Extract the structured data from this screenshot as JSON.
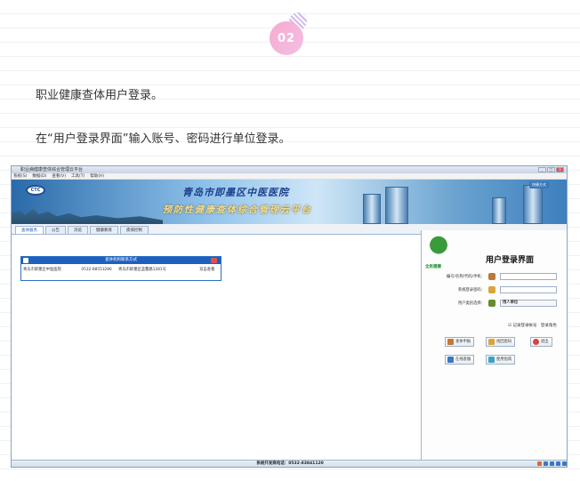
{
  "step_badge": "02",
  "paragraphs": {
    "p1": "职业健康查体用户登录。",
    "p2": "在“用户登录界面”输入账号、密码进行单位登录。"
  },
  "window": {
    "title": "职业病健康查体综合管理云平台",
    "menu": [
      "系统(S)",
      "数据(D)",
      "查看(V)",
      "工具(T)",
      "帮助(H)"
    ],
    "shortcut_label": "快捷方式"
  },
  "banner": {
    "logo_text": "CTC",
    "hospital": "青岛市即墨区中医医院",
    "platform": "预防性健康查体综合管理云平台"
  },
  "tabs": [
    "查体服务",
    "公告",
    "浏览",
    "健康教育",
    "疾病控制"
  ],
  "contact_panel": {
    "header": "查体机构联系方式",
    "name": "青岛市即墨区中医医院",
    "phone": "0532-88553286",
    "address": "青岛市即墨区蓝鳌路1281号",
    "action": "双击查看"
  },
  "login": {
    "logo_caption": "全民健康",
    "title": "用户登录界面",
    "fields": [
      {
        "label": "编号/名称/代码/手机：",
        "value": "",
        "icon": "user-icon"
      },
      {
        "label": "系统登录密码：",
        "value": "",
        "icon": "lock-icon"
      },
      {
        "label": "用户类别选择：",
        "value": "用人单位",
        "icon": "group-icon"
      }
    ],
    "remember": "记录登录帐号",
    "role_login": "登录角色",
    "buttons": {
      "register": "查体申报",
      "login": "找回密码",
      "exit": "退出",
      "online_service": "在线客服",
      "help": "使用指南"
    }
  },
  "statusbar": {
    "text": "系统开发商电话：0532-83841120"
  },
  "colors": {
    "accent": "#1f5fbf",
    "badge": "#f4a8d0"
  }
}
